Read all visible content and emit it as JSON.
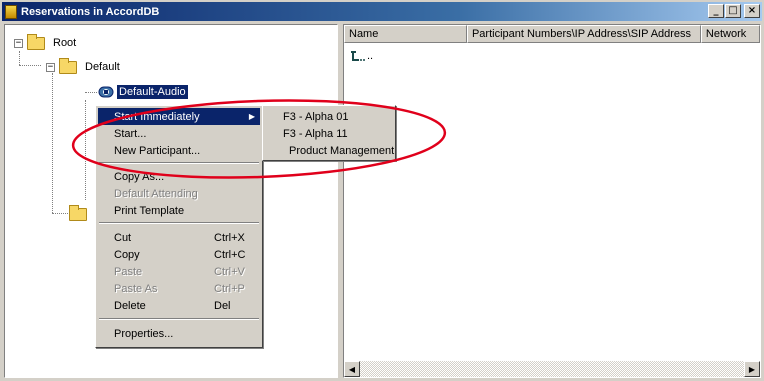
{
  "window": {
    "title": "Reservations in AccordDB",
    "controls": {
      "minimize": "_",
      "maximize": "□",
      "close": "×"
    }
  },
  "tree": {
    "root": {
      "label": "Root",
      "expander": "−"
    },
    "default": {
      "label": "Default",
      "expander": "−"
    },
    "selected": {
      "label": "Default-Audio"
    }
  },
  "list": {
    "columns": [
      "Name",
      "Participant Numbers\\IP Address\\SIP Address",
      "Network"
    ],
    "rows": [
      {
        "name": ".."
      }
    ]
  },
  "context_menu": {
    "items": [
      {
        "label": "Start Immediately",
        "submenu": true,
        "state": "active"
      },
      {
        "label": "Start...",
        "state": "enabled"
      },
      {
        "label": "New Participant...",
        "state": "enabled"
      },
      {
        "label": "Copy As...",
        "state": "enabled"
      },
      {
        "label": "Default Attending",
        "state": "disabled"
      },
      {
        "label": "Print Template",
        "state": "enabled"
      },
      {
        "label": "Cut",
        "shortcut": "Ctrl+X",
        "state": "enabled"
      },
      {
        "label": "Copy",
        "shortcut": "Ctrl+C",
        "state": "enabled"
      },
      {
        "label": "Paste",
        "shortcut": "Ctrl+V",
        "state": "disabled"
      },
      {
        "label": "Paste As",
        "shortcut": "Ctrl+P",
        "state": "disabled"
      },
      {
        "label": "Delete",
        "shortcut": "Del",
        "state": "enabled"
      },
      {
        "label": "Properties...",
        "state": "enabled"
      }
    ]
  },
  "submenu": {
    "items": [
      "F3 - Alpha 01",
      "F3 - Alpha 11",
      "Product Management"
    ]
  },
  "colors": {
    "selection": "#0a246a",
    "annotation": "#e0001b"
  }
}
